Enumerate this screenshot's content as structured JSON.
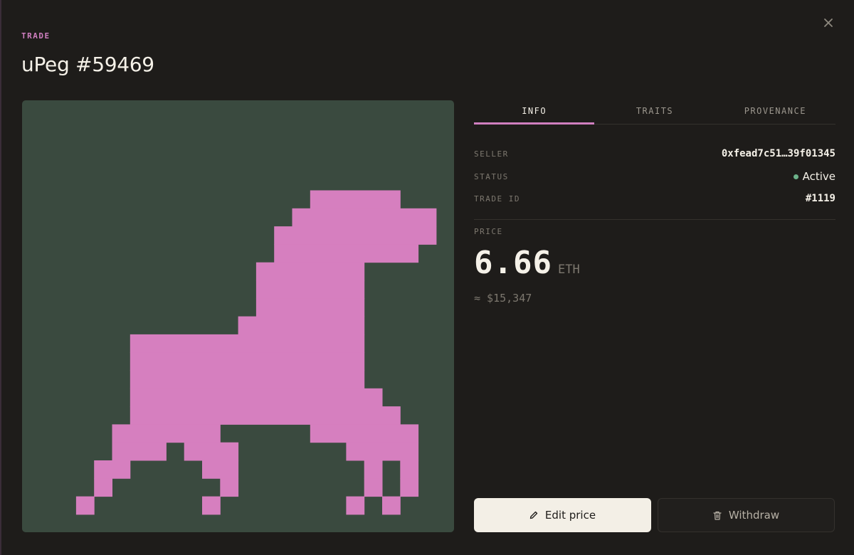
{
  "header": {
    "eyebrow": "TRADE",
    "title": "uPeg #59469"
  },
  "icons": {
    "close": "close-icon",
    "edit": "pencil-icon",
    "withdraw": "trash-icon"
  },
  "artwork": {
    "subject": "pixel-art pegasus",
    "background_color": "#3a4a3f",
    "figure_color": "#d67fbf"
  },
  "tabs": [
    {
      "label": "INFO",
      "active": true
    },
    {
      "label": "TRAITS",
      "active": false
    },
    {
      "label": "PROVENANCE",
      "active": false
    }
  ],
  "info": {
    "seller_label": "SELLER",
    "seller_value": "0xfead7c51…39f01345",
    "status_label": "STATUS",
    "status_value": "Active",
    "status_color": "#6cb28a",
    "trade_id_label": "TRADE ID",
    "trade_id_value": "#1119"
  },
  "price": {
    "label": "PRICE",
    "value": "6.66",
    "unit": "ETH",
    "fiat": "≈ $15,347"
  },
  "actions": {
    "edit_label": "Edit price",
    "withdraw_label": "Withdraw"
  },
  "colors": {
    "accent": "#d07fc0",
    "background": "#1e1c1a"
  }
}
